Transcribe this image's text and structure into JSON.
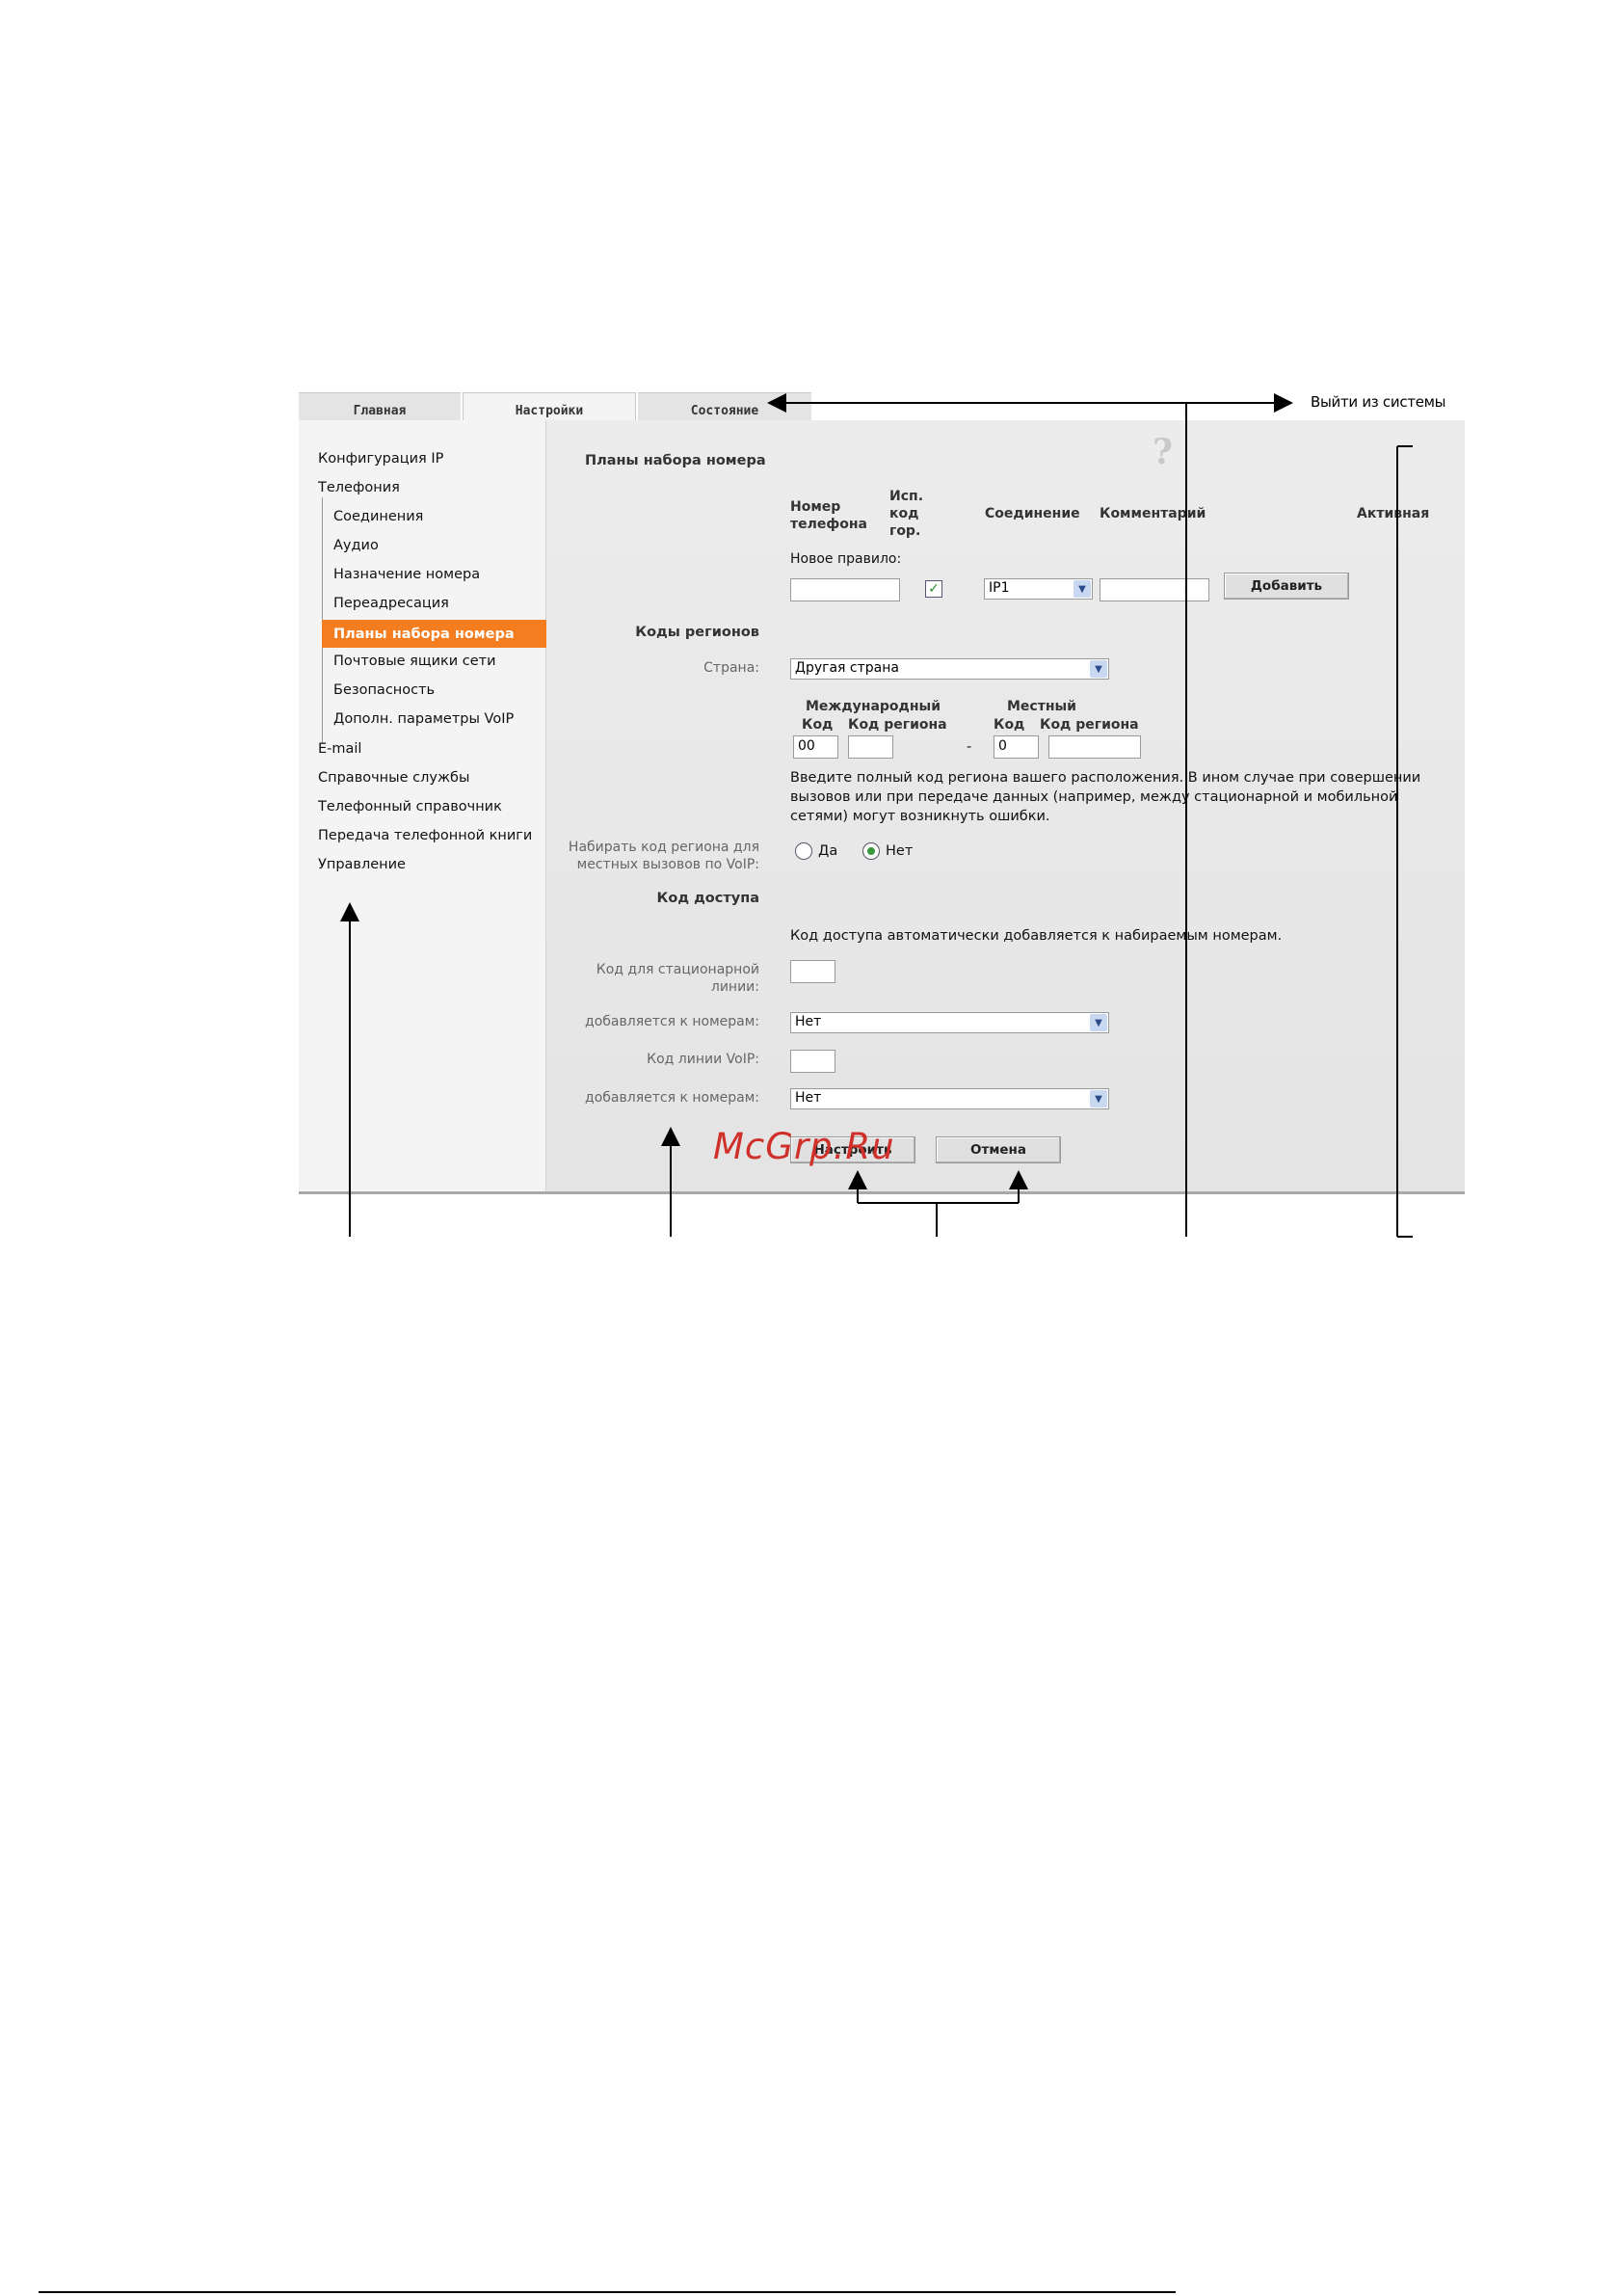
{
  "tabs": [
    {
      "label": "Главная"
    },
    {
      "label": "Настройки"
    },
    {
      "label": "Состояние"
    }
  ],
  "logout_label": "Выйти из системы",
  "help_icon": "?",
  "sidebar": {
    "items": [
      {
        "label": "Конфигурация IP"
      },
      {
        "label": "Телефония"
      },
      {
        "label": "Соединения"
      },
      {
        "label": "Аудио"
      },
      {
        "label": "Назначение номера"
      },
      {
        "label": "Переадресация"
      },
      {
        "label": "Планы набора номера"
      },
      {
        "label": "Почтовые ящики сети"
      },
      {
        "label": "Безопасность"
      },
      {
        "label": "Дополн. параметры VoIP"
      },
      {
        "label": "E-mail"
      },
      {
        "label": "Справочные службы"
      },
      {
        "label": "Телефонный справочник"
      },
      {
        "label": "Передача телефонной книги"
      },
      {
        "label": "Управление"
      }
    ],
    "active_color": "#f47d20"
  },
  "dial_plans": {
    "title": "Планы набора номера",
    "col_phone": "Номер телефона",
    "col_use_code": "Исп. код гор.",
    "col_connection": "Соединение",
    "col_comment": "Комментарий",
    "col_active": "Активная",
    "new_rule_label": "Новое правило:",
    "phone_value": "",
    "use_code_checked": true,
    "connection_value": "IP1",
    "comment_value": "",
    "add_button": "Добавить"
  },
  "area_codes": {
    "title": "Коды регионов",
    "country_label": "Страна:",
    "country_value": "Другая страна",
    "intl_header": "Международный",
    "local_header": "Местный",
    "code_header": "Код",
    "region_code_header": "Код региона",
    "intl_code_value": "00",
    "intl_region_value": "",
    "separator": "-",
    "local_code_value": "0",
    "local_region_value": "",
    "info_line1": "Введите полный код региона вашего расположения. В ином случае при совершении",
    "info_line2": "вызовов или при передаче данных (например, между стационарной и мобильной",
    "info_line3": "сетями) могут возникнуть ошибки.",
    "dial_local_label_1": "Набирать код региона для",
    "dial_local_label_2": "местных вызовов по VoIP:",
    "yes_label": "Да",
    "no_label": "Нет",
    "selected": "Нет"
  },
  "access_code": {
    "title": "Код доступа",
    "info": "Код доступа автоматически добавляется к набираемым номерам.",
    "fixed_line_label_1": "Код для стационарной",
    "fixed_line_label_2": "линии:",
    "fixed_line_value": "",
    "added_to_label": "добавляется к номерам:",
    "added_to_value": "Нет",
    "voip_label": "Код линии VoIP:",
    "voip_value": "",
    "voip_added_to_label": "добавляется к номерам:",
    "voip_added_to_value": "Нет"
  },
  "buttons": {
    "apply": "Настроить",
    "cancel": "Отмена"
  },
  "watermark": "McGrp.Ru"
}
